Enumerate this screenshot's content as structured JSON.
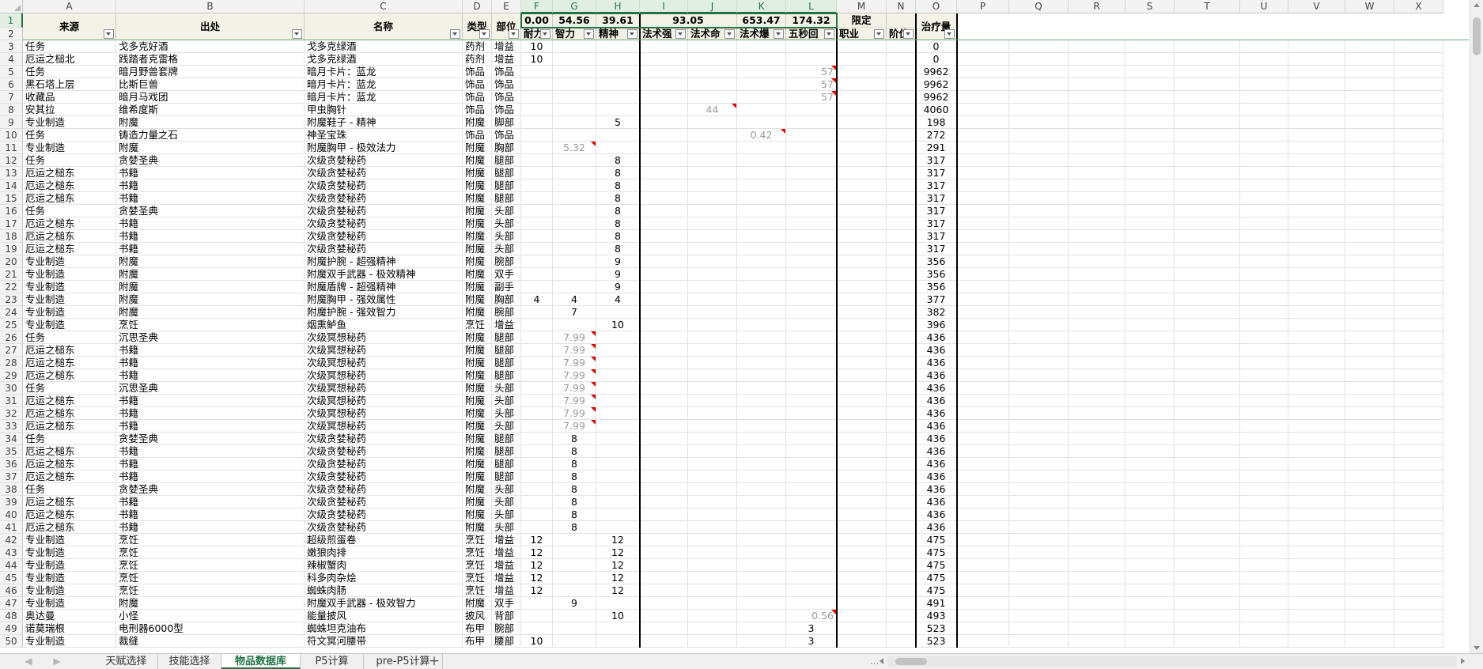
{
  "columns": [
    "A",
    "B",
    "C",
    "D",
    "E",
    "F",
    "G",
    "H",
    "I",
    "J",
    "K",
    "L",
    "M",
    "N",
    "O",
    "P",
    "Q",
    "R",
    "S",
    "T",
    "U",
    "V",
    "W",
    "X"
  ],
  "header_row1": {
    "A": "来源",
    "B": "出处",
    "C": "名称",
    "D": "类型",
    "E": "部位",
    "F": "0.00",
    "G": "54.56",
    "H": "39.61",
    "IJ": "93.05",
    "K": "653.47",
    "L": "174.32",
    "M": "限定",
    "N": "",
    "O": "治疗量"
  },
  "header_row2": {
    "F": "耐力",
    "G": "智力",
    "H": "精神",
    "I": "法术强",
    "J": "法术命",
    "K": "法术爆",
    "L": "五秒回",
    "M": "职业",
    "N": "阶位"
  },
  "rows": [
    {
      "n": "3",
      "A": "任务",
      "B": "戈多克好酒",
      "C": "戈多克绿酒",
      "D": "药剂",
      "E": "增益",
      "F": "10",
      "G": "",
      "H": "",
      "J": "",
      "K": "",
      "L": "",
      "O": "0"
    },
    {
      "n": "4",
      "A": "厄运之槌北",
      "B": "践踏者克雷格",
      "C": "戈多克绿酒",
      "D": "药剂",
      "E": "增益",
      "F": "10",
      "G": "",
      "H": "",
      "J": "",
      "K": "",
      "L": "",
      "O": "0"
    },
    {
      "n": "5",
      "A": "任务",
      "B": "暗月野兽套牌",
      "C": "暗月卡片：蓝龙",
      "D": "饰品",
      "E": "饰品",
      "F": "",
      "G": "",
      "H": "",
      "J": "",
      "K": "",
      "L": "57",
      "O": "9962"
    },
    {
      "n": "6",
      "A": "黑石塔上层",
      "B": "比斯巨兽",
      "C": "暗月卡片：蓝龙",
      "D": "饰品",
      "E": "饰品",
      "F": "",
      "G": "",
      "H": "",
      "J": "",
      "K": "",
      "L": "57",
      "O": "9962"
    },
    {
      "n": "7",
      "A": "收藏品",
      "B": "暗月马戏团",
      "C": "暗月卡片：蓝龙",
      "D": "饰品",
      "E": "饰品",
      "F": "",
      "G": "",
      "H": "",
      "J": "",
      "K": "",
      "L": "57",
      "O": "9962"
    },
    {
      "n": "8",
      "A": "安其拉",
      "B": "维希度斯",
      "C": "甲虫胸针",
      "D": "饰品",
      "E": "饰品",
      "F": "",
      "G": "",
      "H": "",
      "J": "44",
      "K": "",
      "L": "",
      "O": "4060"
    },
    {
      "n": "9",
      "A": "专业制造",
      "B": "附魔",
      "C": "附魔鞋子 - 精神",
      "D": "附魔",
      "E": "脚部",
      "F": "",
      "G": "",
      "H": "5",
      "J": "",
      "K": "",
      "L": "",
      "O": "198"
    },
    {
      "n": "10",
      "A": "任务",
      "B": "铸造力量之石",
      "C": "神圣宝珠",
      "D": "饰品",
      "E": "饰品",
      "F": "",
      "G": "",
      "H": "",
      "J": "",
      "K": "0.42",
      "L": "",
      "O": "272"
    },
    {
      "n": "11",
      "A": "专业制造",
      "B": "附魔",
      "C": "附魔胸甲 - 极效法力",
      "D": "附魔",
      "E": "胸部",
      "F": "",
      "G": "5.32",
      "H": "",
      "J": "",
      "K": "",
      "L": "",
      "O": "291"
    },
    {
      "n": "12",
      "A": "任务",
      "B": "贪婪圣典",
      "C": "次级贪婪秘药",
      "D": "附魔",
      "E": "腿部",
      "F": "",
      "G": "",
      "H": "8",
      "J": "",
      "K": "",
      "L": "",
      "O": "317"
    },
    {
      "n": "13",
      "A": "厄运之槌东",
      "B": "书籍",
      "C": "次级贪婪秘药",
      "D": "附魔",
      "E": "腿部",
      "F": "",
      "G": "",
      "H": "8",
      "J": "",
      "K": "",
      "L": "",
      "O": "317"
    },
    {
      "n": "14",
      "A": "厄运之槌东",
      "B": "书籍",
      "C": "次级贪婪秘药",
      "D": "附魔",
      "E": "腿部",
      "F": "",
      "G": "",
      "H": "8",
      "J": "",
      "K": "",
      "L": "",
      "O": "317"
    },
    {
      "n": "15",
      "A": "厄运之槌东",
      "B": "书籍",
      "C": "次级贪婪秘药",
      "D": "附魔",
      "E": "腿部",
      "F": "",
      "G": "",
      "H": "8",
      "J": "",
      "K": "",
      "L": "",
      "O": "317"
    },
    {
      "n": "16",
      "A": "任务",
      "B": "贪婪圣典",
      "C": "次级贪婪秘药",
      "D": "附魔",
      "E": "头部",
      "F": "",
      "G": "",
      "H": "8",
      "J": "",
      "K": "",
      "L": "",
      "O": "317"
    },
    {
      "n": "17",
      "A": "厄运之槌东",
      "B": "书籍",
      "C": "次级贪婪秘药",
      "D": "附魔",
      "E": "头部",
      "F": "",
      "G": "",
      "H": "8",
      "J": "",
      "K": "",
      "L": "",
      "O": "317"
    },
    {
      "n": "18",
      "A": "厄运之槌东",
      "B": "书籍",
      "C": "次级贪婪秘药",
      "D": "附魔",
      "E": "头部",
      "F": "",
      "G": "",
      "H": "8",
      "J": "",
      "K": "",
      "L": "",
      "O": "317"
    },
    {
      "n": "19",
      "A": "厄运之槌东",
      "B": "书籍",
      "C": "次级贪婪秘药",
      "D": "附魔",
      "E": "头部",
      "F": "",
      "G": "",
      "H": "8",
      "J": "",
      "K": "",
      "L": "",
      "O": "317"
    },
    {
      "n": "20",
      "A": "专业制造",
      "B": "附魔",
      "C": "附魔护腕 - 超强精神",
      "D": "附魔",
      "E": "腕部",
      "F": "",
      "G": "",
      "H": "9",
      "J": "",
      "K": "",
      "L": "",
      "O": "356"
    },
    {
      "n": "21",
      "A": "专业制造",
      "B": "附魔",
      "C": "附魔双手武器 - 极效精神",
      "D": "附魔",
      "E": "双手",
      "F": "",
      "G": "",
      "H": "9",
      "J": "",
      "K": "",
      "L": "",
      "O": "356"
    },
    {
      "n": "22",
      "A": "专业制造",
      "B": "附魔",
      "C": "附魔盾牌 - 超强精神",
      "D": "附魔",
      "E": "副手",
      "F": "",
      "G": "",
      "H": "9",
      "J": "",
      "K": "",
      "L": "",
      "O": "356"
    },
    {
      "n": "23",
      "A": "专业制造",
      "B": "附魔",
      "C": "附魔胸甲 - 强效属性",
      "D": "附魔",
      "E": "胸部",
      "F": "4",
      "G": "4",
      "H": "4",
      "J": "",
      "K": "",
      "L": "",
      "O": "377"
    },
    {
      "n": "24",
      "A": "专业制造",
      "B": "附魔",
      "C": "附魔护腕 - 强效智力",
      "D": "附魔",
      "E": "腕部",
      "F": "",
      "G": "7",
      "H": "",
      "J": "",
      "K": "",
      "L": "",
      "O": "382"
    },
    {
      "n": "25",
      "A": "专业制造",
      "B": "烹饪",
      "C": "烟熏鲈鱼",
      "D": "烹饪",
      "E": "增益",
      "F": "",
      "G": "",
      "H": "10",
      "J": "",
      "K": "",
      "L": "",
      "O": "396"
    },
    {
      "n": "26",
      "A": "任务",
      "B": "沉思圣典",
      "C": "次级冥想秘药",
      "D": "附魔",
      "E": "腿部",
      "F": "",
      "G": "7.99",
      "H": "",
      "J": "",
      "K": "",
      "L": "",
      "O": "436"
    },
    {
      "n": "27",
      "A": "厄运之槌东",
      "B": "书籍",
      "C": "次级冥想秘药",
      "D": "附魔",
      "E": "腿部",
      "F": "",
      "G": "7.99",
      "H": "",
      "J": "",
      "K": "",
      "L": "",
      "O": "436"
    },
    {
      "n": "28",
      "A": "厄运之槌东",
      "B": "书籍",
      "C": "次级冥想秘药",
      "D": "附魔",
      "E": "腿部",
      "F": "",
      "G": "7.99",
      "H": "",
      "J": "",
      "K": "",
      "L": "",
      "O": "436"
    },
    {
      "n": "29",
      "A": "厄运之槌东",
      "B": "书籍",
      "C": "次级冥想秘药",
      "D": "附魔",
      "E": "腿部",
      "F": "",
      "G": "7.99",
      "H": "",
      "J": "",
      "K": "",
      "L": "",
      "O": "436"
    },
    {
      "n": "30",
      "A": "任务",
      "B": "沉思圣典",
      "C": "次级冥想秘药",
      "D": "附魔",
      "E": "头部",
      "F": "",
      "G": "7.99",
      "H": "",
      "J": "",
      "K": "",
      "L": "",
      "O": "436"
    },
    {
      "n": "31",
      "A": "厄运之槌东",
      "B": "书籍",
      "C": "次级冥想秘药",
      "D": "附魔",
      "E": "头部",
      "F": "",
      "G": "7.99",
      "H": "",
      "J": "",
      "K": "",
      "L": "",
      "O": "436"
    },
    {
      "n": "32",
      "A": "厄运之槌东",
      "B": "书籍",
      "C": "次级冥想秘药",
      "D": "附魔",
      "E": "头部",
      "F": "",
      "G": "7.99",
      "H": "",
      "J": "",
      "K": "",
      "L": "",
      "O": "436"
    },
    {
      "n": "33",
      "A": "厄运之槌东",
      "B": "书籍",
      "C": "次级冥想秘药",
      "D": "附魔",
      "E": "头部",
      "F": "",
      "G": "7.99",
      "H": "",
      "J": "",
      "K": "",
      "L": "",
      "O": "436"
    },
    {
      "n": "34",
      "A": "任务",
      "B": "贪婪圣典",
      "C": "次级贪婪秘药",
      "D": "附魔",
      "E": "腿部",
      "F": "",
      "G": "8",
      "H": "",
      "J": "",
      "K": "",
      "L": "",
      "O": "436"
    },
    {
      "n": "35",
      "A": "厄运之槌东",
      "B": "书籍",
      "C": "次级贪婪秘药",
      "D": "附魔",
      "E": "腿部",
      "F": "",
      "G": "8",
      "H": "",
      "J": "",
      "K": "",
      "L": "",
      "O": "436"
    },
    {
      "n": "36",
      "A": "厄运之槌东",
      "B": "书籍",
      "C": "次级贪婪秘药",
      "D": "附魔",
      "E": "腿部",
      "F": "",
      "G": "8",
      "H": "",
      "J": "",
      "K": "",
      "L": "",
      "O": "436"
    },
    {
      "n": "37",
      "A": "厄运之槌东",
      "B": "书籍",
      "C": "次级贪婪秘药",
      "D": "附魔",
      "E": "腿部",
      "F": "",
      "G": "8",
      "H": "",
      "J": "",
      "K": "",
      "L": "",
      "O": "436"
    },
    {
      "n": "38",
      "A": "任务",
      "B": "贪婪圣典",
      "C": "次级贪婪秘药",
      "D": "附魔",
      "E": "头部",
      "F": "",
      "G": "8",
      "H": "",
      "J": "",
      "K": "",
      "L": "",
      "O": "436"
    },
    {
      "n": "39",
      "A": "厄运之槌东",
      "B": "书籍",
      "C": "次级贪婪秘药",
      "D": "附魔",
      "E": "头部",
      "F": "",
      "G": "8",
      "H": "",
      "J": "",
      "K": "",
      "L": "",
      "O": "436"
    },
    {
      "n": "40",
      "A": "厄运之槌东",
      "B": "书籍",
      "C": "次级贪婪秘药",
      "D": "附魔",
      "E": "头部",
      "F": "",
      "G": "8",
      "H": "",
      "J": "",
      "K": "",
      "L": "",
      "O": "436"
    },
    {
      "n": "41",
      "A": "厄运之槌东",
      "B": "书籍",
      "C": "次级贪婪秘药",
      "D": "附魔",
      "E": "头部",
      "F": "",
      "G": "8",
      "H": "",
      "J": "",
      "K": "",
      "L": "",
      "O": "436"
    },
    {
      "n": "42",
      "A": "专业制造",
      "B": "烹饪",
      "C": "超级煎蛋卷",
      "D": "烹饪",
      "E": "增益",
      "F": "12",
      "G": "",
      "H": "12",
      "J": "",
      "K": "",
      "L": "",
      "O": "475"
    },
    {
      "n": "43",
      "A": "专业制造",
      "B": "烹饪",
      "C": "嫩狼肉排",
      "D": "烹饪",
      "E": "增益",
      "F": "12",
      "G": "",
      "H": "12",
      "J": "",
      "K": "",
      "L": "",
      "O": "475"
    },
    {
      "n": "44",
      "A": "专业制造",
      "B": "烹饪",
      "C": "辣椒蟹肉",
      "D": "烹饪",
      "E": "增益",
      "F": "12",
      "G": "",
      "H": "12",
      "J": "",
      "K": "",
      "L": "",
      "O": "475"
    },
    {
      "n": "45",
      "A": "专业制造",
      "B": "烹饪",
      "C": "科多肉杂烩",
      "D": "烹饪",
      "E": "增益",
      "F": "12",
      "G": "",
      "H": "12",
      "J": "",
      "K": "",
      "L": "",
      "O": "475"
    },
    {
      "n": "46",
      "A": "专业制造",
      "B": "烹饪",
      "C": "蜘蛛肉肠",
      "D": "烹饪",
      "E": "增益",
      "F": "12",
      "G": "",
      "H": "12",
      "J": "",
      "K": "",
      "L": "",
      "O": "475"
    },
    {
      "n": "47",
      "A": "专业制造",
      "B": "附魔",
      "C": "附魔双手武器 - 极效智力",
      "D": "附魔",
      "E": "双手",
      "F": "",
      "G": "9",
      "H": "",
      "J": "",
      "K": "",
      "L": "",
      "O": "491"
    },
    {
      "n": "48",
      "A": "奥达曼",
      "B": "小怪",
      "C": "能量披风",
      "D": "披风",
      "E": "背部",
      "F": "",
      "G": "",
      "H": "10",
      "J": "",
      "K": "",
      "L": "0.56",
      "O": "493"
    },
    {
      "n": "49",
      "A": "诺莫瑞根",
      "B": "电刑器6000型",
      "C": "蜘蛛坦克油布",
      "D": "布甲",
      "E": "腕部",
      "F": "",
      "G": "",
      "H": "",
      "J": "",
      "K": "",
      "L": "3",
      "O": "523"
    },
    {
      "n": "50",
      "A": "专业制造",
      "B": "裁缝",
      "C": "符文冥河腰带",
      "D": "布甲",
      "E": "腰部",
      "F": "10",
      "G": "",
      "H": "",
      "J": "",
      "K": "",
      "L": "3",
      "O": "523"
    }
  ],
  "sheet_tabs": [
    {
      "label": "天赋选择",
      "active": false
    },
    {
      "label": "技能选择",
      "active": false
    },
    {
      "label": "物品数据库",
      "active": true
    },
    {
      "label": "P5计算",
      "active": false
    },
    {
      "label": "pre-P5计算",
      "active": false
    }
  ],
  "nav": {
    "prev": "◀",
    "next": "▶",
    "more": "...",
    "add": "+"
  },
  "colors": {
    "accent": "#217346",
    "header_fill": "#f4f2e6",
    "comment_marker": "#e00000"
  }
}
